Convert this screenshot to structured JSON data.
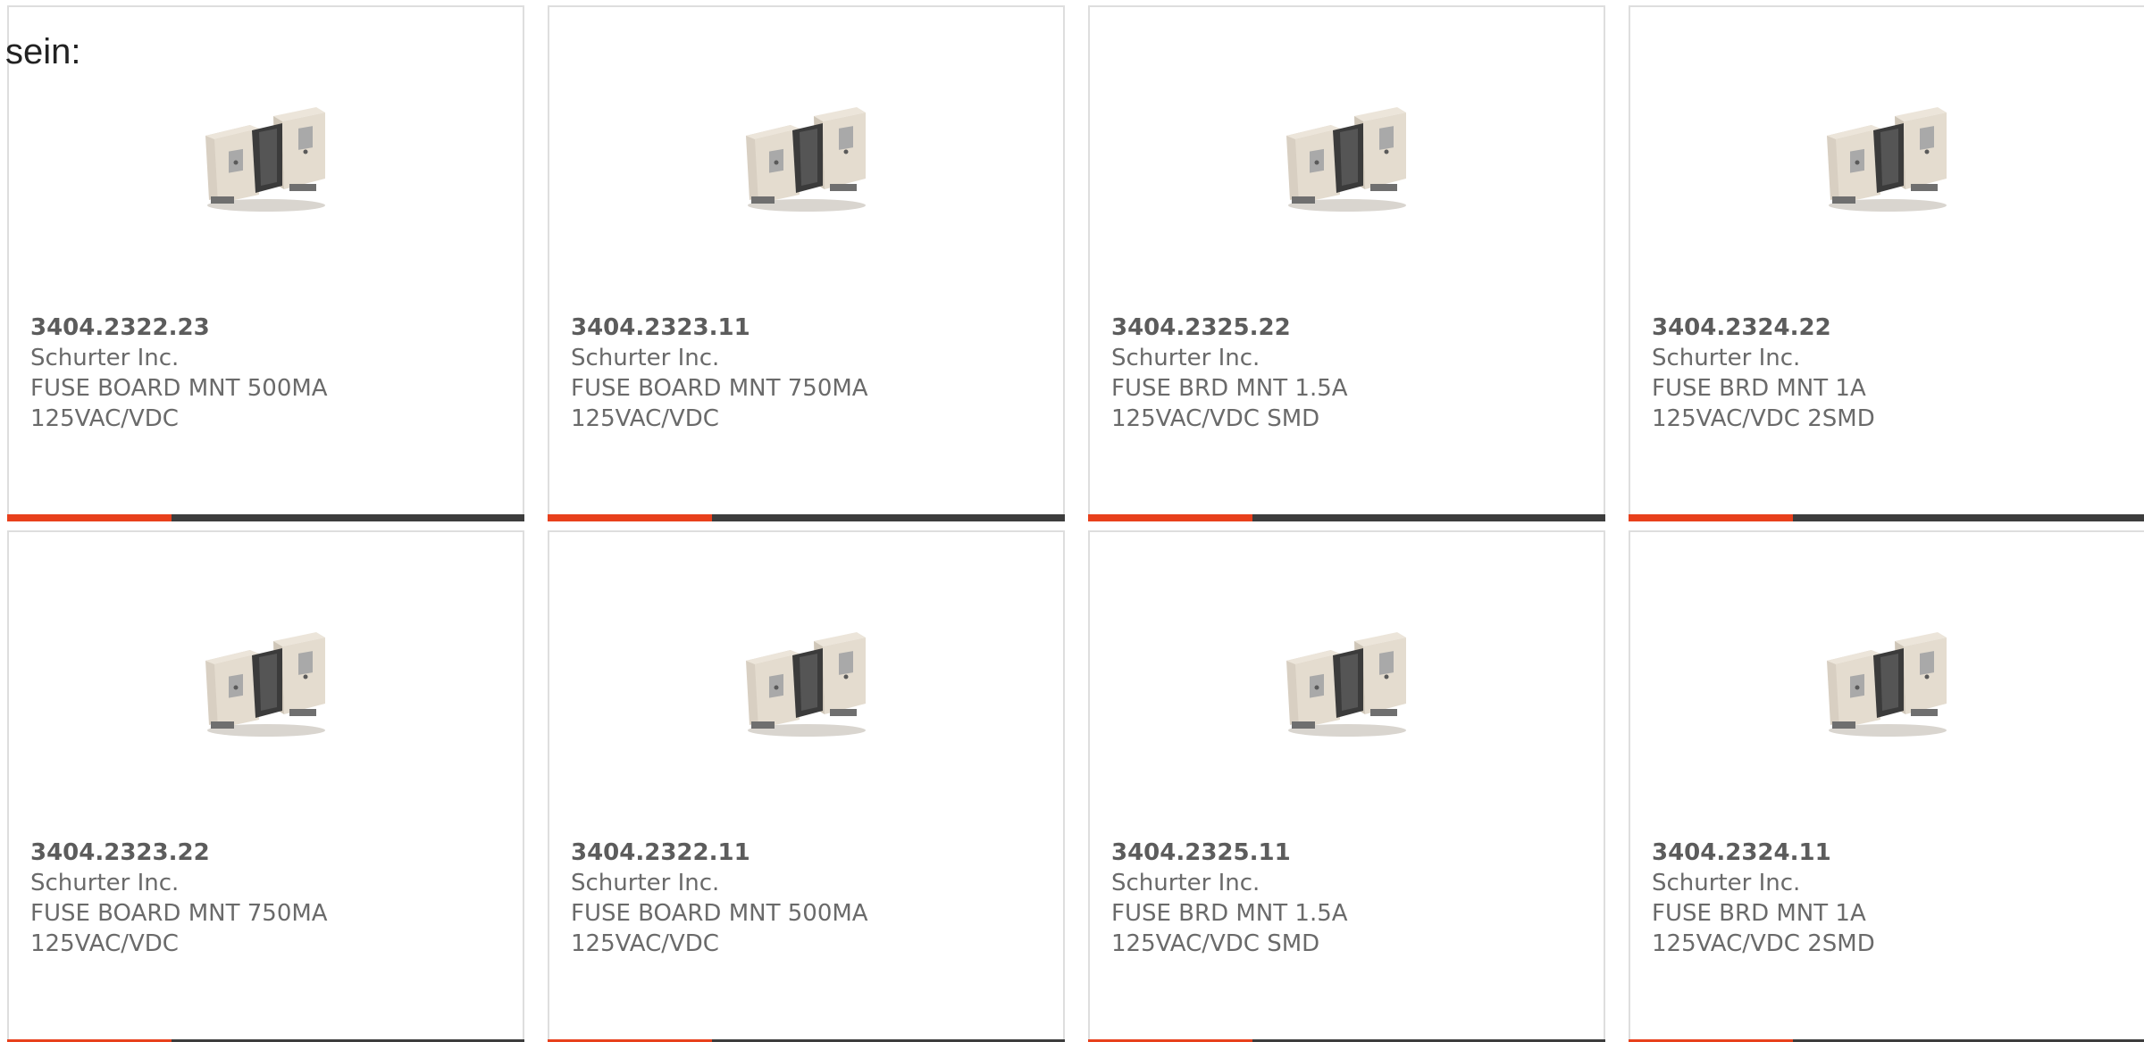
{
  "lead_text": "sein:",
  "colors": {
    "accent": "#e8401c",
    "bar": "#3d3d3d",
    "border": "#dedede",
    "text": "#6a6a6a"
  },
  "image_icon": "fuse-holder-icon",
  "products": [
    {
      "part": "3404.2322.23",
      "maker": "Schurter Inc.",
      "desc": "FUSE BOARD MNT 500MA 125VAC/VDC"
    },
    {
      "part": "3404.2323.11",
      "maker": "Schurter Inc.",
      "desc": "FUSE BOARD MNT 750MA 125VAC/VDC"
    },
    {
      "part": "3404.2325.22",
      "maker": "Schurter Inc.",
      "desc": "FUSE BRD MNT 1.5A 125VAC/VDC SMD"
    },
    {
      "part": "3404.2324.22",
      "maker": "Schurter Inc.",
      "desc": "FUSE BRD MNT 1A 125VAC/VDC 2SMD"
    },
    {
      "part": "3404.2323.22",
      "maker": "Schurter Inc.",
      "desc": "FUSE BOARD MNT 750MA 125VAC/VDC"
    },
    {
      "part": "3404.2322.11",
      "maker": "Schurter Inc.",
      "desc": "FUSE BOARD MNT 500MA 125VAC/VDC"
    },
    {
      "part": "3404.2325.11",
      "maker": "Schurter Inc.",
      "desc": "FUSE BRD MNT 1.5A 125VAC/VDC SMD"
    },
    {
      "part": "3404.2324.11",
      "maker": "Schurter Inc.",
      "desc": "FUSE BRD MNT 1A 125VAC/VDC 2SMD"
    }
  ]
}
